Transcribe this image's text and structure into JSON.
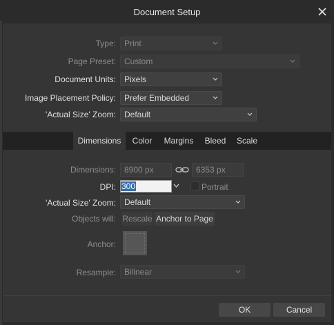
{
  "dialog": {
    "title": "Document Setup"
  },
  "form": {
    "type_label": "Type:",
    "type_value": "Print",
    "page_preset_label": "Page Preset:",
    "page_preset_value": "Custom",
    "document_units_label": "Document Units:",
    "document_units_value": "Pixels",
    "image_placement_label": "Image Placement Policy:",
    "image_placement_value": "Prefer Embedded",
    "actual_size_zoom_label": "'Actual Size' Zoom:",
    "actual_size_zoom_value": "Default"
  },
  "tabs": [
    {
      "label": "Dimensions",
      "active": true
    },
    {
      "label": "Color",
      "active": false
    },
    {
      "label": "Margins",
      "active": false
    },
    {
      "label": "Bleed",
      "active": false
    },
    {
      "label": "Scale",
      "active": false
    }
  ],
  "dimensions": {
    "dimensions_label": "Dimensions:",
    "width_value": "8900 px",
    "height_value": "6353 px",
    "dpi_label": "DPI:",
    "dpi_value": "300",
    "portrait_label": "Portrait",
    "portrait_checked": false,
    "actual_size_zoom_label": "'Actual Size' Zoom:",
    "actual_size_zoom_value": "Default",
    "objects_will_label": "Objects will:",
    "rescale_label": "Rescale",
    "anchor_to_page_label": "Anchor to Page",
    "anchor_label": "Anchor:",
    "resample_label": "Resample:",
    "resample_value": "Bilinear"
  },
  "footer": {
    "ok_label": "OK",
    "cancel_label": "Cancel"
  },
  "icons": {
    "close": "close-icon",
    "link": "link-icon",
    "chevron": "chevron-down-icon"
  },
  "colors": {
    "background": "#353535",
    "title_bar": "#2b2b2b",
    "tab_bar": "#222222",
    "selection": "#3b6ea8"
  }
}
